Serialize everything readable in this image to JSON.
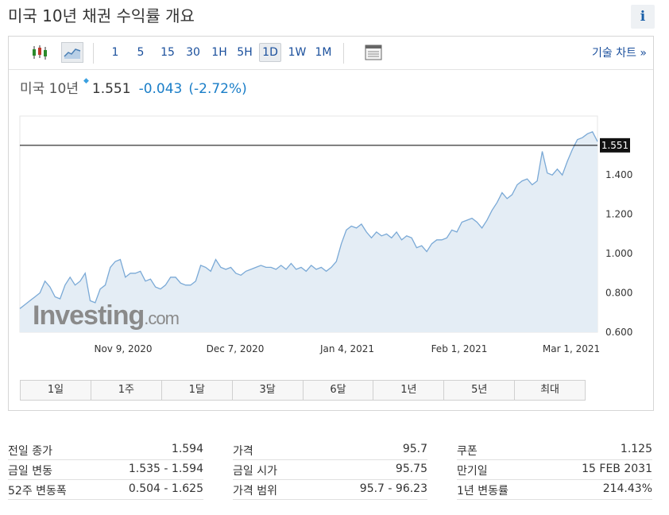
{
  "page": {
    "title": "미국 10년 채권 수익률 개요",
    "info_icon": "i"
  },
  "toolbar": {
    "chart_type_icons": [
      "candlestick-icon",
      "area-chart-icon"
    ],
    "timeframes": [
      "1",
      "5",
      "15",
      "30",
      "1H",
      "5H",
      "1D",
      "1W",
      "1M"
    ],
    "active_timeframe": "1D",
    "settings_icon": "data-table-icon",
    "advanced_chart_label": "기술 차트 »"
  },
  "quote": {
    "name": "미국 10년",
    "price": "1.551",
    "change": "-0.043",
    "change_pct": "(-2.72%)"
  },
  "chart_data": {
    "type": "area",
    "y_ticks": [
      "1.400",
      "1.200",
      "1.000",
      "0.800",
      "0.600"
    ],
    "ylim": [
      0.6,
      1.7
    ],
    "x_ticks": [
      "Nov 9, 2020",
      "Dec 7, 2020",
      "Jan 4, 2021",
      "Feb 1, 2021",
      "Mar 1, 2021"
    ],
    "current_price_label": "1.551",
    "current_price": 1.551,
    "watermark": "Investing.com",
    "colors": {
      "line": "#7aa9d6",
      "fill": "#e4edf5",
      "price_line": "#000000"
    },
    "series": [
      {
        "values": [
          0.72,
          0.74,
          0.76,
          0.78,
          0.8,
          0.86,
          0.83,
          0.78,
          0.77,
          0.84,
          0.88,
          0.84,
          0.86,
          0.9,
          0.76,
          0.75,
          0.82,
          0.84,
          0.93,
          0.96,
          0.97,
          0.88,
          0.9,
          0.9,
          0.91,
          0.86,
          0.87,
          0.83,
          0.82,
          0.84,
          0.88,
          0.88,
          0.85,
          0.84,
          0.84,
          0.86,
          0.94,
          0.93,
          0.91,
          0.97,
          0.93,
          0.92,
          0.93,
          0.9,
          0.89,
          0.91,
          0.92,
          0.93,
          0.94,
          0.93,
          0.93,
          0.92,
          0.94,
          0.92,
          0.95,
          0.92,
          0.93,
          0.91,
          0.94,
          0.92,
          0.93,
          0.91,
          0.93,
          0.96,
          1.05,
          1.12,
          1.14,
          1.13,
          1.15,
          1.11,
          1.08,
          1.11,
          1.09,
          1.1,
          1.08,
          1.11,
          1.07,
          1.09,
          1.08,
          1.03,
          1.04,
          1.01,
          1.05,
          1.07,
          1.07,
          1.08,
          1.12,
          1.11,
          1.16,
          1.17,
          1.18,
          1.16,
          1.13,
          1.17,
          1.22,
          1.26,
          1.31,
          1.28,
          1.3,
          1.35,
          1.37,
          1.38,
          1.35,
          1.37,
          1.52,
          1.41,
          1.4,
          1.43,
          1.4,
          1.47,
          1.53,
          1.58,
          1.59,
          1.61,
          1.62,
          1.57
        ]
      }
    ]
  },
  "range_buttons": [
    "1일",
    "1주",
    "1달",
    "3달",
    "6달",
    "1년",
    "5년",
    "최대"
  ],
  "stats": [
    [
      {
        "label": "전일 종가",
        "value": "1.594"
      },
      {
        "label": "금일 변동",
        "value": "1.535 - 1.594"
      },
      {
        "label": "52주 변동폭",
        "value": "0.504 - 1.625"
      }
    ],
    [
      {
        "label": "가격",
        "value": "95.7"
      },
      {
        "label": "금일 시가",
        "value": "95.75"
      },
      {
        "label": "가격 범위",
        "value": "95.7 - 96.23"
      }
    ],
    [
      {
        "label": "쿠폰",
        "value": "1.125"
      },
      {
        "label": "만기일",
        "value": "15 FEB 2031"
      },
      {
        "label": "1년 변동률",
        "value": "214.43%"
      }
    ]
  ]
}
